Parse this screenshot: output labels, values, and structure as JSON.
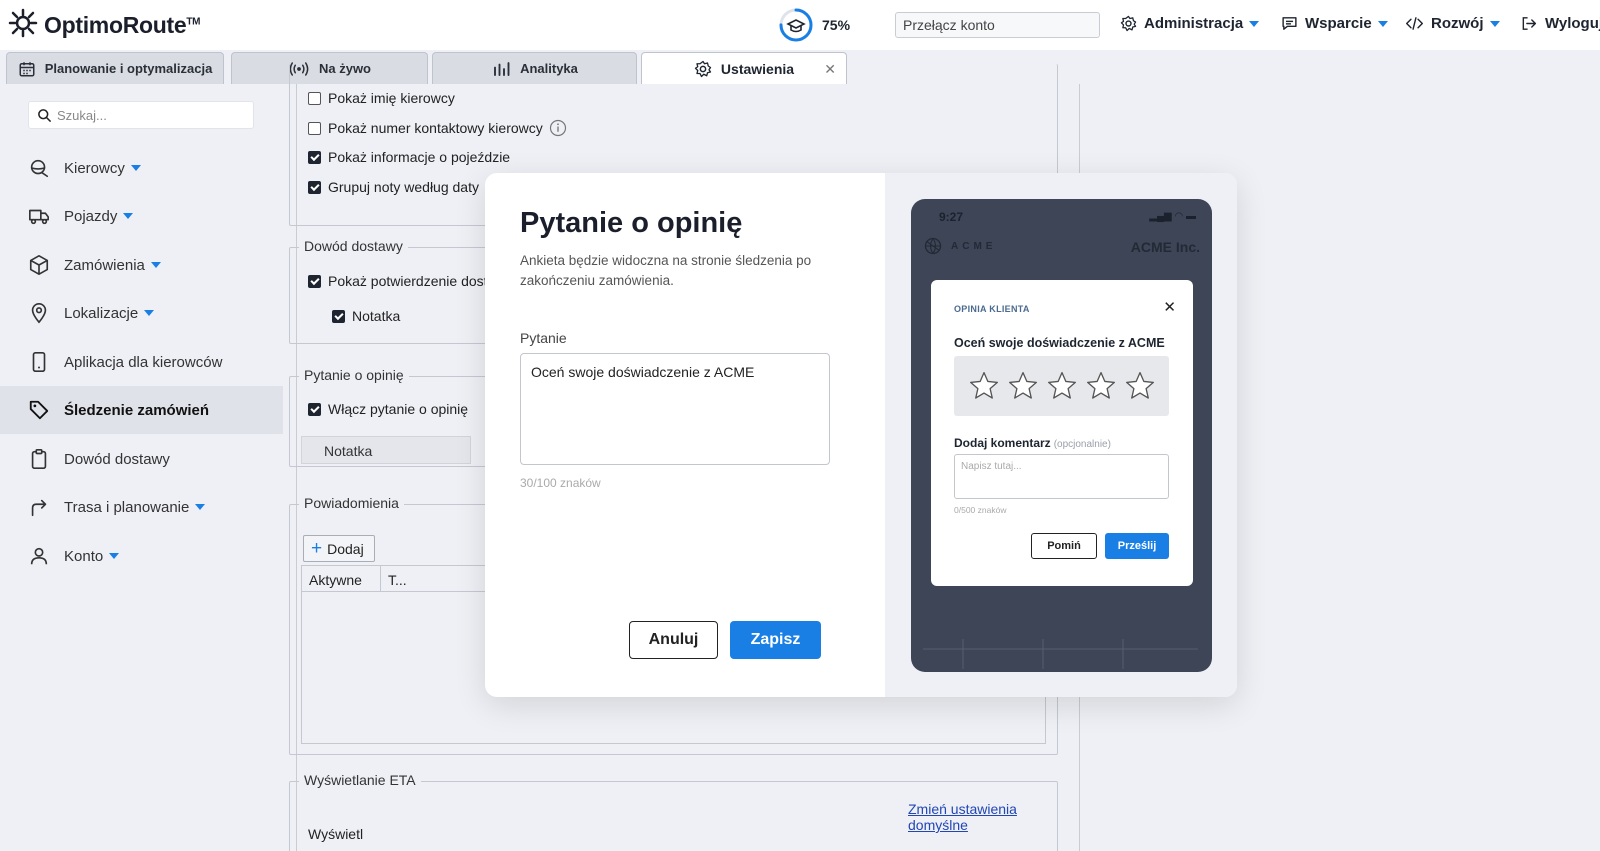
{
  "app": {
    "name": "OptimoRoute",
    "trademark": "TM"
  },
  "header": {
    "progress": {
      "value": 75,
      "label": "75%"
    },
    "account_switch_placeholder": "Przełącz konto",
    "nav": [
      {
        "label": "Administracja",
        "icon": "gear-icon"
      },
      {
        "label": "Wsparcie",
        "icon": "chat-icon"
      },
      {
        "label": "Rozwój",
        "icon": "code-icon"
      },
      {
        "label": "Wyloguj",
        "icon": "logout-icon"
      }
    ]
  },
  "tabs": [
    {
      "label": "Planowanie i optymalizacja",
      "icon": "calendar-icon"
    },
    {
      "label": "Na żywo",
      "icon": "broadcast-icon"
    },
    {
      "label": "Analityka",
      "icon": "bar-chart-icon"
    },
    {
      "label": "Ustawienia",
      "icon": "gear-icon",
      "active": true
    }
  ],
  "sidebar": {
    "search_placeholder": "Szukaj...",
    "items": [
      {
        "label": "Kierowcy",
        "icon": "steering-icon",
        "dropdown": true
      },
      {
        "label": "Pojazdy",
        "icon": "truck-icon",
        "dropdown": true
      },
      {
        "label": "Zamówienia",
        "icon": "box-icon",
        "dropdown": true
      },
      {
        "label": "Lokalizacje",
        "icon": "pin-icon",
        "dropdown": true
      },
      {
        "label": "Aplikacja dla kierowców",
        "icon": "phone-icon",
        "dropdown": false
      },
      {
        "label": "Śledzenie zamówień",
        "icon": "tag-icon",
        "dropdown": false,
        "active": true
      },
      {
        "label": "Dowód dostawy",
        "icon": "clipboard-icon",
        "dropdown": false
      },
      {
        "label": "Trasa i planowanie",
        "icon": "route-icon",
        "dropdown": true
      },
      {
        "label": "Konto",
        "icon": "user-icon",
        "dropdown": true
      }
    ]
  },
  "settings": {
    "top_options": [
      {
        "label": "Pokaż imię kierowcy",
        "checked": false
      },
      {
        "label": "Pokaż numer kontaktowy kierowcy",
        "checked": false,
        "info": true
      },
      {
        "label": "Pokaż informacje o pojeździe",
        "checked": true
      },
      {
        "label": "Grupuj noty według daty",
        "checked": true
      }
    ],
    "proof": {
      "legend": "Dowód dostawy",
      "option": "Pokaż potwierdzenie dostawy",
      "sub_option": "Notatka"
    },
    "feedback": {
      "legend": "Pytanie o opinię",
      "option": "Włącz pytanie o opinię",
      "field": "Notatka"
    },
    "notifications": {
      "legend": "Powiadomienia",
      "add_label": "Dodaj",
      "columns": [
        "Aktywne",
        "T..."
      ]
    },
    "eta": {
      "legend": "Wyświetlanie ETA",
      "link": "Zmień ustawienia domyślne",
      "label": "Wyświetl"
    }
  },
  "modal": {
    "title": "Pytanie o opinię",
    "description": "Ankieta będzie widoczna na stronie śledzenia po zakończeniu zamówienia.",
    "question_label": "Pytanie",
    "question_value": "Oceń swoje doświadczenie z ACME",
    "char_count": "30/100 znaków",
    "cancel_label": "Anuluj",
    "save_label": "Zapisz"
  },
  "preview": {
    "time": "9:27",
    "brand": "ACME",
    "company": "ACME Inc.",
    "survey": {
      "heading": "OPINIA KLIENTA",
      "question": "Oceń swoje doświadczenie z ACME",
      "stars": 5,
      "comment_label": "Dodaj komentarz",
      "comment_optional": "(opcjonalnie)",
      "comment_placeholder": "Napisz tutaj...",
      "char_count": "0/500 znaków",
      "skip_label": "Pomiń",
      "submit_label": "Prześlij"
    }
  },
  "colors": {
    "accent": "#1a7fe5",
    "dark": "#1e2530",
    "overlay_bg": "#eef0f5"
  }
}
